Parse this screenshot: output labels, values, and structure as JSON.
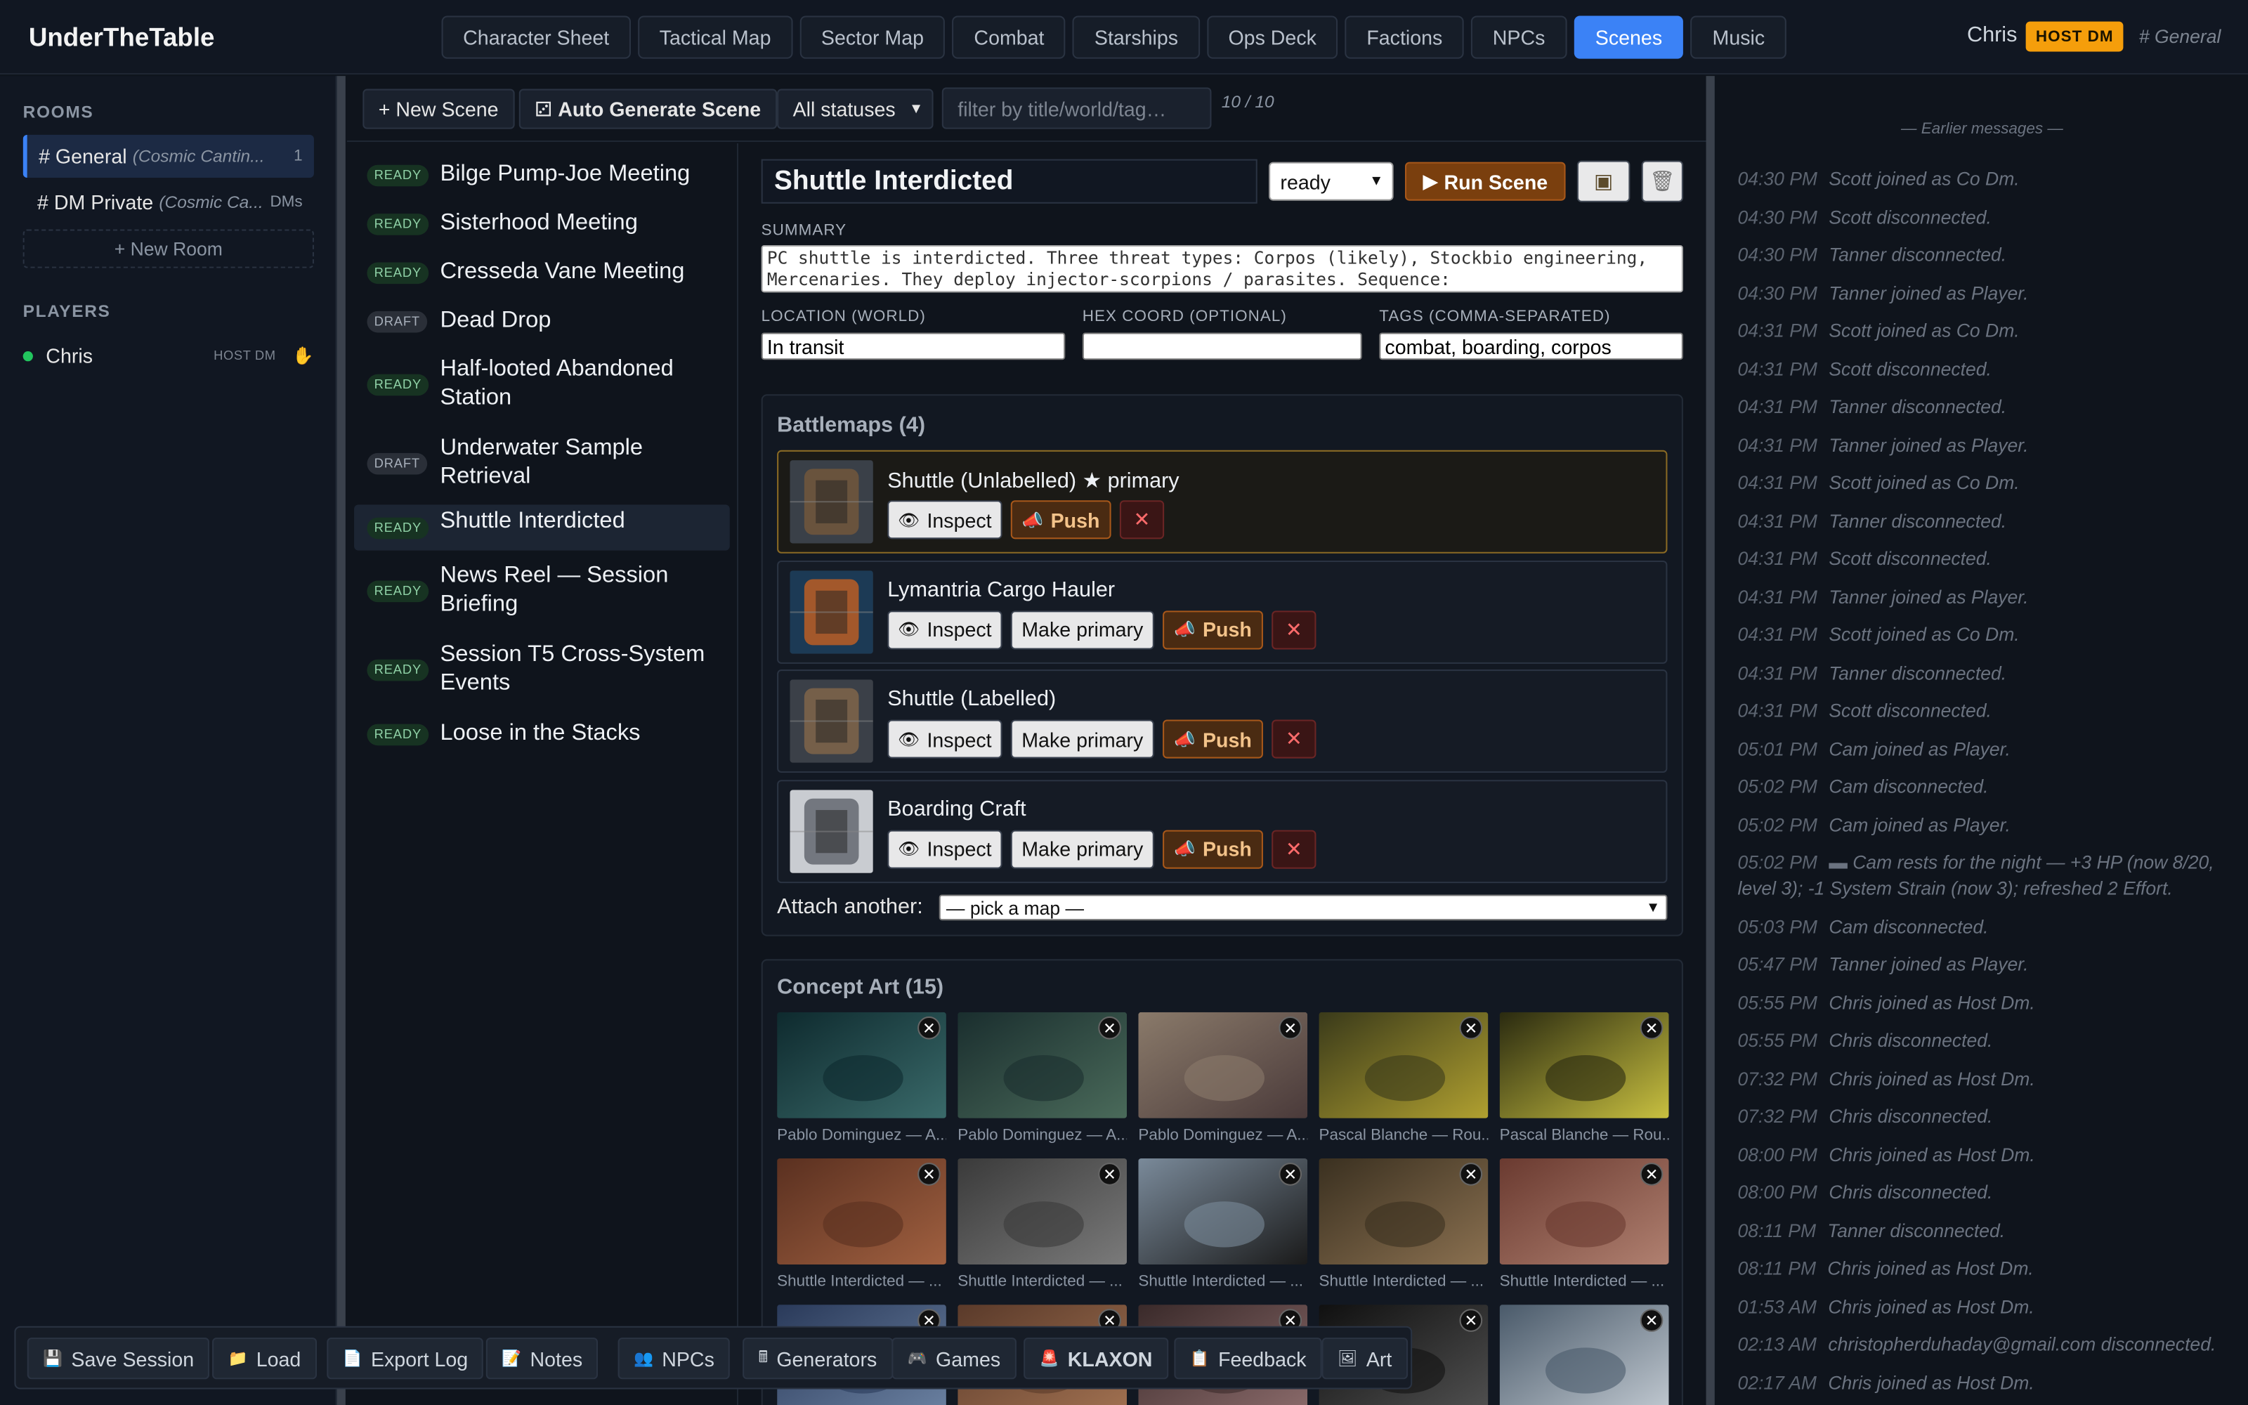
{
  "app": {
    "brand": "UnderTheTable",
    "user": "Chris",
    "role_badge": "HOST DM",
    "channel": "# General"
  },
  "nav": [
    "Character Sheet",
    "Tactical Map",
    "Sector Map",
    "Combat",
    "Starships",
    "Ops Deck",
    "Factions",
    "NPCs",
    "Scenes",
    "Music"
  ],
  "nav_active": "Scenes",
  "sidebar": {
    "rooms_heading": "ROOMS",
    "rooms": [
      {
        "name": "# General",
        "world": "(Cosmic Cantin...",
        "count": "1"
      },
      {
        "name": "# DM Private",
        "world": "(Cosmic Ca...",
        "count": "DMs"
      }
    ],
    "new_room": "+ New Room",
    "players_heading": "PLAYERS",
    "players": [
      {
        "name": "Chris",
        "role": "HOST DM",
        "icon": "hand-icon"
      }
    ]
  },
  "toolbar": {
    "new_scene": "+ New Scene",
    "auto_generate": "Auto Generate Scene",
    "status_filter": "All statuses",
    "filter_placeholder": "filter by title/world/tag…",
    "count": "10 / 10"
  },
  "scenes": [
    {
      "status": "READY",
      "title": "Bilge Pump-Joe Meeting"
    },
    {
      "status": "READY",
      "title": "Sisterhood Meeting"
    },
    {
      "status": "READY",
      "title": "Cresseda Vane Meeting"
    },
    {
      "status": "DRAFT",
      "title": "Dead Drop"
    },
    {
      "status": "READY",
      "title": "Half-looted Abandoned Station"
    },
    {
      "status": "DRAFT",
      "title": "Underwater Sample Retrieval"
    },
    {
      "status": "READY",
      "title": "Shuttle Interdicted"
    },
    {
      "status": "READY",
      "title": "News Reel — Session Briefing"
    },
    {
      "status": "READY",
      "title": "Session T5 Cross-System Events"
    },
    {
      "status": "READY",
      "title": "Loose in the Stacks"
    }
  ],
  "editor": {
    "title": "Shuttle Interdicted",
    "status": "ready",
    "run": "Run Scene",
    "summary_label": "SUMMARY",
    "summary": "PC shuttle is interdicted. Three threat types: Corpos (likely), Stockbio engineering, Mercenaries. They deploy injector-scorpions / parasites. Sequence:",
    "location_label": "LOCATION (WORLD)",
    "location": "In transit",
    "hex_label": "HEX COORD (OPTIONAL)",
    "hex": "",
    "tags_label": "TAGS (COMMA-SEPARATED)",
    "tags": "combat, boarding, corpos"
  },
  "battlemaps": {
    "heading": "Battlemaps (4)",
    "inspect": "Inspect",
    "make_primary": "Make primary",
    "push": "Push",
    "items": [
      {
        "name": "Shuttle (Unlabelled) ★ primary",
        "primary": true
      },
      {
        "name": "Lymantria Cargo Hauler",
        "primary": false
      },
      {
        "name": "Shuttle (Labelled)",
        "primary": false
      },
      {
        "name": "Boarding Craft",
        "primary": false
      }
    ],
    "attach_label": "Attach another:",
    "attach_select": "— pick a map —"
  },
  "concept_art": {
    "heading": "Concept Art (15)",
    "items": [
      {
        "caption": "Pablo Dominguez — A..."
      },
      {
        "caption": "Pablo Dominguez — A..."
      },
      {
        "caption": "Pablo Dominguez — A..."
      },
      {
        "caption": "Pascal Blanche — Rou..."
      },
      {
        "caption": "Pascal Blanche — Rou..."
      },
      {
        "caption": "Shuttle Interdicted — ..."
      },
      {
        "caption": "Shuttle Interdicted — ..."
      },
      {
        "caption": "Shuttle Interdicted — ..."
      },
      {
        "caption": "Shuttle Interdicted — ..."
      },
      {
        "caption": "Shuttle Interdicted — ..."
      }
    ]
  },
  "log": {
    "earlier": "— Earlier messages —",
    "lines": [
      {
        "t": "04:30 PM",
        "m": "Scott joined as Co Dm."
      },
      {
        "t": "04:30 PM",
        "m": "Scott disconnected."
      },
      {
        "t": "04:30 PM",
        "m": "Tanner disconnected."
      },
      {
        "t": "04:30 PM",
        "m": "Tanner joined as Player."
      },
      {
        "t": "04:31 PM",
        "m": "Scott joined as Co Dm."
      },
      {
        "t": "04:31 PM",
        "m": "Scott disconnected."
      },
      {
        "t": "04:31 PM",
        "m": "Tanner disconnected."
      },
      {
        "t": "04:31 PM",
        "m": "Tanner joined as Player."
      },
      {
        "t": "04:31 PM",
        "m": "Scott joined as Co Dm."
      },
      {
        "t": "04:31 PM",
        "m": "Tanner disconnected."
      },
      {
        "t": "04:31 PM",
        "m": "Scott disconnected."
      },
      {
        "t": "04:31 PM",
        "m": "Tanner joined as Player."
      },
      {
        "t": "04:31 PM",
        "m": "Scott joined as Co Dm."
      },
      {
        "t": "04:31 PM",
        "m": "Tanner disconnected."
      },
      {
        "t": "04:31 PM",
        "m": "Scott disconnected."
      },
      {
        "t": "05:01 PM",
        "m": "Cam joined as Player."
      },
      {
        "t": "05:02 PM",
        "m": "Cam disconnected."
      },
      {
        "t": "05:02 PM",
        "m": "Cam joined as Player."
      },
      {
        "t": "05:02 PM",
        "m": "▬ Cam rests for the night — +3 HP (now 8/20, level 3); -1 System Strain (now 3); refreshed 2 Effort."
      },
      {
        "t": "05:03 PM",
        "m": "Cam disconnected."
      },
      {
        "t": "05:47 PM",
        "m": "Tanner joined as Player."
      },
      {
        "t": "05:55 PM",
        "m": "Chris joined as Host Dm."
      },
      {
        "t": "05:55 PM",
        "m": "Chris disconnected."
      },
      {
        "t": "07:32 PM",
        "m": "Chris joined as Host Dm."
      },
      {
        "t": "07:32 PM",
        "m": "Chris disconnected."
      },
      {
        "t": "08:00 PM",
        "m": "Chris joined as Host Dm."
      },
      {
        "t": "08:00 PM",
        "m": "Chris disconnected."
      },
      {
        "t": "08:11 PM",
        "m": "Tanner disconnected."
      },
      {
        "t": "08:11 PM",
        "m": "Chris joined as Host Dm."
      },
      {
        "t": "01:53 AM",
        "m": "Chris joined as Host Dm."
      },
      {
        "t": "02:13 AM",
        "m": "christopherduhaday@gmail.com disconnected."
      },
      {
        "t": "02:17 AM",
        "m": "Chris joined as Host Dm."
      }
    ]
  },
  "bottom": [
    "Save Session",
    "Load",
    "Export Log",
    "Notes",
    "NPCs",
    "Generators",
    "Games",
    "KLAXON",
    "Feedback",
    "Art"
  ],
  "bottom_icons": [
    "floppy-icon",
    "folder-icon",
    "page-icon",
    "notes-icon",
    "people-icon",
    "generator-icon",
    "gamepad-icon",
    "siren-icon",
    "clipboard-icon",
    "picture-icon"
  ]
}
